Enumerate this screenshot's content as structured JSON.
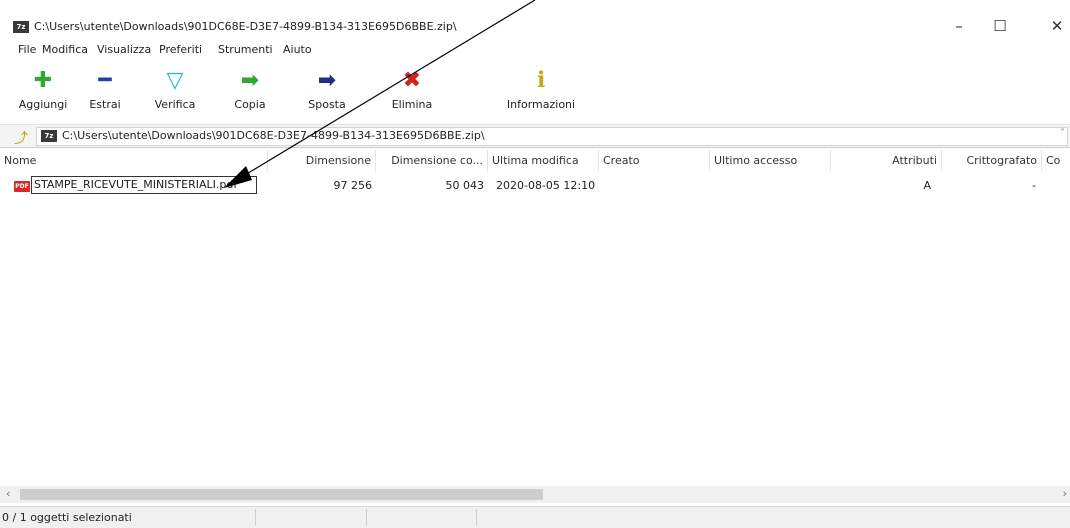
{
  "window": {
    "title": "C:\\Users\\utente\\Downloads\\901DC68E-D3E7-4899-B134-313E695D6BBE.zip\\",
    "app_icon": "7z",
    "minimize_icon": "minimize-icon",
    "maximize_icon": "maximize-icon",
    "close_icon": "close-icon"
  },
  "menu": [
    {
      "label": "File"
    },
    {
      "label": "Modifica"
    },
    {
      "label": "Visualizza"
    },
    {
      "label": "Preferiti"
    },
    {
      "label": "Strumenti"
    },
    {
      "label": "Aiuto"
    }
  ],
  "toolbar": [
    {
      "label": "Aggiungi",
      "icon": "add-icon",
      "glyph": "✚",
      "color": "#2fa836"
    },
    {
      "label": "Estrai",
      "icon": "extract-icon",
      "glyph": "━",
      "color": "#1e3fae"
    },
    {
      "label": "Verifica",
      "icon": "verify-icon",
      "glyph": "▽",
      "color": "#27b5c9"
    },
    {
      "label": "Copia",
      "icon": "copy-icon",
      "glyph": "➡",
      "color": "#2fa836"
    },
    {
      "label": "Sposta",
      "icon": "move-icon",
      "glyph": "➡",
      "color": "#1e2f8c"
    },
    {
      "label": "Elimina",
      "icon": "delete-icon",
      "glyph": "✖",
      "color": "#d21f1f"
    },
    {
      "label": "Informazioni",
      "icon": "info-icon",
      "glyph": "ℹ",
      "color": "#c8a616"
    }
  ],
  "address": {
    "path": "C:\\Users\\utente\\Downloads\\901DC68E-D3E7-4899-B134-313E695D6BBE.zip\\",
    "icon": "7z"
  },
  "columns": [
    {
      "label": "Nome"
    },
    {
      "label": "Dimensione"
    },
    {
      "label": "Dimensione co..."
    },
    {
      "label": "Ultima modifica"
    },
    {
      "label": "Creato"
    },
    {
      "label": "Ultimo accesso"
    },
    {
      "label": "Attributi"
    },
    {
      "label": "Crittografato"
    },
    {
      "label": "Co"
    }
  ],
  "files": [
    {
      "name": "STAMPE_RICEVUTE_MINISTERIALI.pdf",
      "size": "97 256",
      "packed": "50 043",
      "modified": "2020-08-05 12:10",
      "created": "",
      "accessed": "",
      "attributes": "A",
      "encrypted": "-",
      "file_icon": "pdf-icon",
      "file_icon_text": "PDF"
    }
  ],
  "status": {
    "selection": "0 / 1 oggetti selezionati"
  },
  "colors": {
    "pdf_icon": "#d62b2b",
    "annotation_arrow": "#000000"
  }
}
